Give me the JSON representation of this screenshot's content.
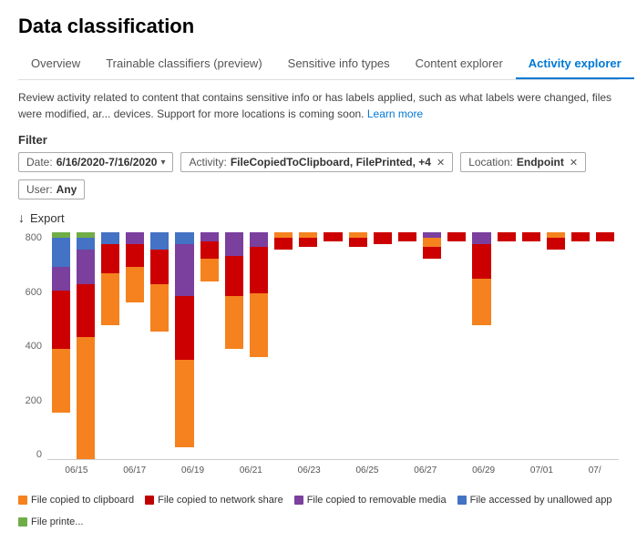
{
  "page": {
    "title": "Data classification"
  },
  "tabs": [
    {
      "id": "overview",
      "label": "Overview",
      "active": false
    },
    {
      "id": "trainable",
      "label": "Trainable classifiers (preview)",
      "active": false
    },
    {
      "id": "sensitive",
      "label": "Sensitive info types",
      "active": false
    },
    {
      "id": "content",
      "label": "Content explorer",
      "active": false
    },
    {
      "id": "activity",
      "label": "Activity explorer",
      "active": true
    }
  ],
  "description": "Review activity related to content that contains sensitive info or has labels applied, such as what labels were changed, files were modified, ar... devices. Support for more locations is coming soon.",
  "learn_more": "Learn more",
  "filter_label": "Filter",
  "filters": [
    {
      "id": "date",
      "label": "Date:",
      "value": "6/16/2020-7/16/2020",
      "has_arrow": true,
      "has_close": false
    },
    {
      "id": "activity",
      "label": "Activity:",
      "value": "FileCopiedToClipboard, FilePrinted, +4",
      "has_arrow": false,
      "has_close": true
    },
    {
      "id": "location",
      "label": "Location:",
      "value": "Endpoint",
      "has_arrow": false,
      "has_close": true
    },
    {
      "id": "user",
      "label": "User:",
      "value": "Any",
      "has_arrow": false,
      "has_close": false
    }
  ],
  "export_label": "Export",
  "chart": {
    "y_labels": [
      "800",
      "600",
      "400",
      "200",
      "0"
    ],
    "x_labels": [
      "06/15",
      "06/17",
      "06/19",
      "06/21",
      "06/23",
      "06/25",
      "06/27",
      "06/29",
      "07/01",
      "07/"
    ],
    "bar_groups": [
      {
        "segments": [
          {
            "color": "#f5821f",
            "pct": 22
          },
          {
            "color": "#c00",
            "pct": 20
          },
          {
            "color": "#7b3f9e",
            "pct": 8
          },
          {
            "color": "#4472c4",
            "pct": 10
          },
          {
            "color": "#70ad47",
            "pct": 2
          }
        ],
        "total": 62
      },
      {
        "segments": [
          {
            "color": "#f5821f",
            "pct": 42
          },
          {
            "color": "#c00",
            "pct": 18
          },
          {
            "color": "#7b3f9e",
            "pct": 12
          },
          {
            "color": "#4472c4",
            "pct": 4
          },
          {
            "color": "#70ad47",
            "pct": 2
          }
        ],
        "total": 78
      },
      {
        "segments": [
          {
            "color": "#f5821f",
            "pct": 18
          },
          {
            "color": "#c00",
            "pct": 10
          },
          {
            "color": "#4472c4",
            "pct": 4
          }
        ],
        "total": 32
      },
      {
        "segments": [
          {
            "color": "#f5821f",
            "pct": 12
          },
          {
            "color": "#c00",
            "pct": 8
          },
          {
            "color": "#7b3f9e",
            "pct": 4
          }
        ],
        "total": 24
      },
      {
        "segments": [
          {
            "color": "#f5821f",
            "pct": 16
          },
          {
            "color": "#c00",
            "pct": 12
          },
          {
            "color": "#4472c4",
            "pct": 6
          }
        ],
        "total": 34
      },
      {
        "segments": [
          {
            "color": "#f5821f",
            "pct": 30
          },
          {
            "color": "#c00",
            "pct": 22
          },
          {
            "color": "#7b3f9e",
            "pct": 18
          },
          {
            "color": "#4472c4",
            "pct": 4
          }
        ],
        "total": 74
      },
      {
        "segments": [
          {
            "color": "#f5821f",
            "pct": 8
          },
          {
            "color": "#c00",
            "pct": 6
          },
          {
            "color": "#7b3f9e",
            "pct": 3
          }
        ],
        "total": 17
      },
      {
        "segments": [
          {
            "color": "#f5821f",
            "pct": 18
          },
          {
            "color": "#c00",
            "pct": 14
          },
          {
            "color": "#7b3f9e",
            "pct": 8
          }
        ],
        "total": 40
      },
      {
        "segments": [
          {
            "color": "#f5821f",
            "pct": 22
          },
          {
            "color": "#c00",
            "pct": 16
          },
          {
            "color": "#7b3f9e",
            "pct": 5
          }
        ],
        "total": 43
      },
      {
        "segments": [
          {
            "color": "#c00",
            "pct": 4
          },
          {
            "color": "#f5821f",
            "pct": 2
          }
        ],
        "total": 6
      },
      {
        "segments": [
          {
            "color": "#c00",
            "pct": 3
          },
          {
            "color": "#f5821f",
            "pct": 2
          }
        ],
        "total": 5
      },
      {
        "segments": [
          {
            "color": "#c00",
            "pct": 3
          }
        ],
        "total": 3
      },
      {
        "segments": [
          {
            "color": "#c00",
            "pct": 3
          },
          {
            "color": "#f5821f",
            "pct": 2
          }
        ],
        "total": 5
      },
      {
        "segments": [
          {
            "color": "#c00",
            "pct": 4
          }
        ],
        "total": 4
      },
      {
        "segments": [
          {
            "color": "#c00",
            "pct": 3
          }
        ],
        "total": 3
      },
      {
        "segments": [
          {
            "color": "#c00",
            "pct": 4
          },
          {
            "color": "#f5821f",
            "pct": 3
          },
          {
            "color": "#7b3f9e",
            "pct": 2
          }
        ],
        "total": 9
      },
      {
        "segments": [
          {
            "color": "#c00",
            "pct": 3
          }
        ],
        "total": 3
      },
      {
        "segments": [
          {
            "color": "#f5821f",
            "pct": 16
          },
          {
            "color": "#c00",
            "pct": 12
          },
          {
            "color": "#7b3f9e",
            "pct": 4
          }
        ],
        "total": 32
      },
      {
        "segments": [
          {
            "color": "#c00",
            "pct": 3
          }
        ],
        "total": 3
      },
      {
        "segments": [
          {
            "color": "#c00",
            "pct": 3
          }
        ],
        "total": 3
      },
      {
        "segments": [
          {
            "color": "#c00",
            "pct": 4
          },
          {
            "color": "#f5821f",
            "pct": 2
          }
        ],
        "total": 6
      },
      {
        "segments": [
          {
            "color": "#c00",
            "pct": 3
          }
        ],
        "total": 3
      },
      {
        "segments": [
          {
            "color": "#c00",
            "pct": 3
          }
        ],
        "total": 3
      }
    ]
  },
  "legend": [
    {
      "color": "#f5821f",
      "label": "File copied to clipboard"
    },
    {
      "color": "#c00000",
      "label": "File copied to network share"
    },
    {
      "color": "#7b3f9e",
      "label": "File copied to removable media"
    },
    {
      "color": "#4472c4",
      "label": "File accessed by unallowed app"
    },
    {
      "color": "#70ad47",
      "label": "File printe..."
    }
  ]
}
